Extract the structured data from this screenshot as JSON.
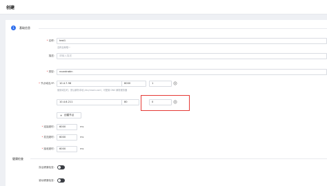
{
  "header": {
    "title": "创建"
  },
  "section": {
    "step": "1",
    "title": "基础信息"
  },
  "form": {
    "name": {
      "label": "名称",
      "value": "test1",
      "hint": "名称全局唯一"
    },
    "desc": {
      "label": "描述",
      "placeholder": "请输入描述"
    },
    "type": {
      "label": "类型",
      "value": "roundrobin"
    },
    "nodes": {
      "label": "节点域名/IP",
      "row1": {
        "host": "10.4.7.98",
        "port": "8000",
        "weight": "1"
      },
      "hint": "使用域名时，默认解析本地 /etc/resolv.conf，可配置 DNS 解析服务器",
      "row2": {
        "host": "10.4.6.211",
        "port": "80",
        "weight": "0"
      },
      "add_label": "创建节点"
    },
    "connect_timeout": {
      "label": "连接超时",
      "value": "6000",
      "unit": "ms"
    },
    "send_timeout": {
      "label": "发送超时",
      "value": "6000",
      "unit": "ms"
    },
    "read_timeout": {
      "label": "接收超时",
      "value": "6000",
      "unit": "ms"
    }
  },
  "health": {
    "title": "健康检查",
    "active_label": "探活健康检查",
    "passive_label": "被动健康检查"
  },
  "colors": {
    "accent": "#2f6fed",
    "highlight": "#e53935"
  }
}
